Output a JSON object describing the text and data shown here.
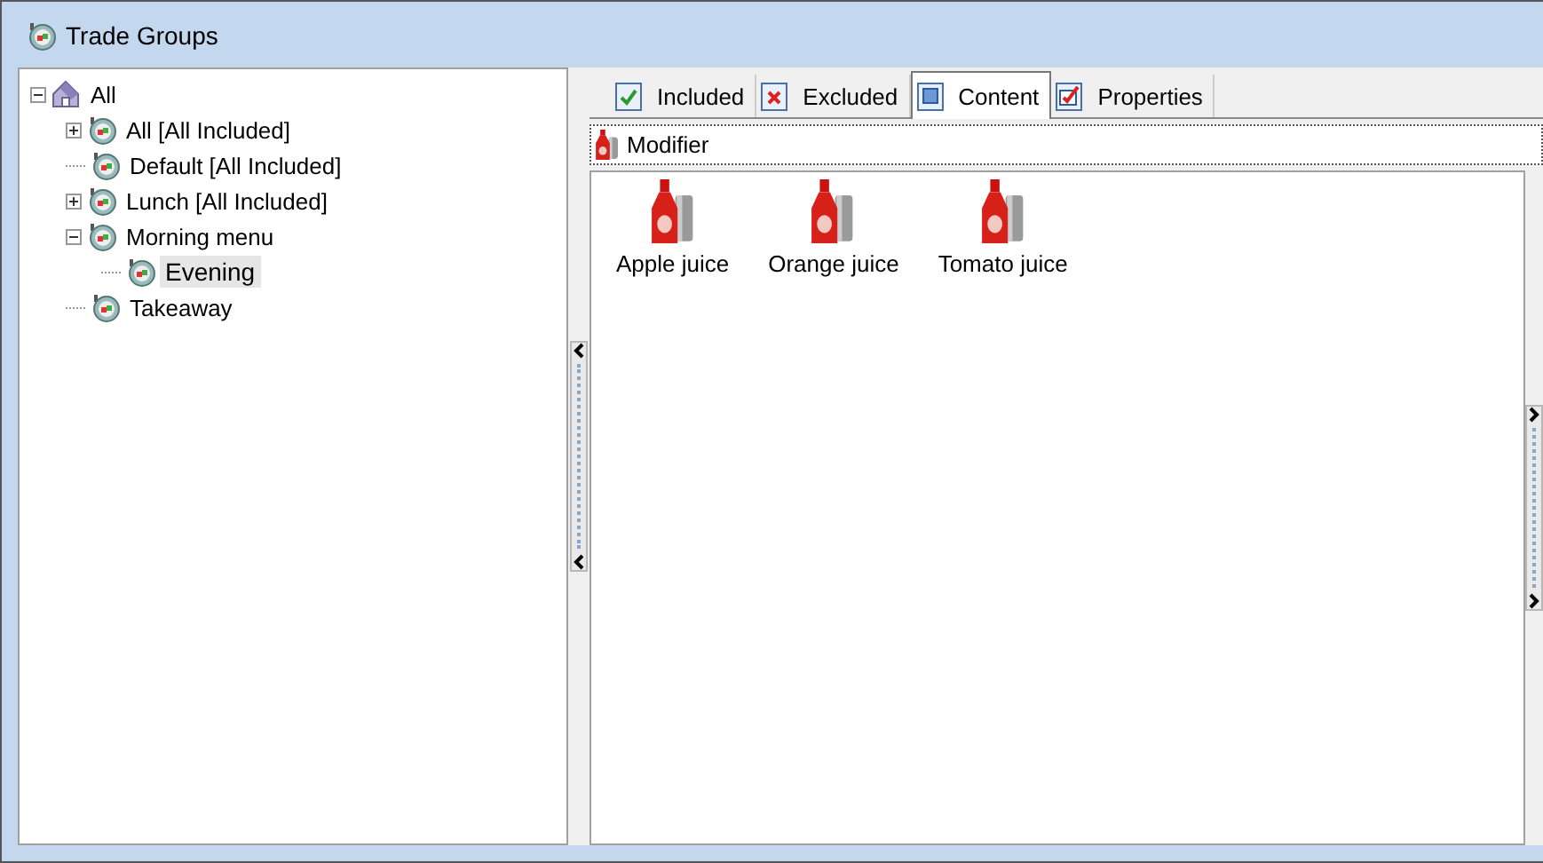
{
  "window": {
    "title": "Trade Groups"
  },
  "tree": [
    {
      "label": "All",
      "kind": "root",
      "expanded": true,
      "selected": false,
      "children": [
        {
          "label": "All [All Included]",
          "kind": "group",
          "expanded": false,
          "selected": false
        },
        {
          "label": "Default [All Included]",
          "kind": "group",
          "selected": false
        },
        {
          "label": "Lunch [All Included]",
          "kind": "group",
          "expanded": false,
          "selected": false
        },
        {
          "label": "Morning menu",
          "kind": "group",
          "expanded": true,
          "selected": false,
          "children": [
            {
              "label": "Evening",
              "kind": "group",
              "selected": true
            }
          ]
        },
        {
          "label": "Takeaway",
          "kind": "group",
          "selected": false
        }
      ]
    }
  ],
  "tabs": [
    {
      "label": "Included",
      "kind": "included",
      "selected": false
    },
    {
      "label": "Excluded",
      "kind": "excluded",
      "selected": false
    },
    {
      "label": "Content",
      "kind": "content",
      "selected": true
    },
    {
      "label": "Properties",
      "kind": "properties",
      "selected": false
    }
  ],
  "category": {
    "label": "Modifier"
  },
  "items": [
    {
      "label": "Apple juice"
    },
    {
      "label": "Orange juice"
    },
    {
      "label": "Tomato juice"
    }
  ]
}
